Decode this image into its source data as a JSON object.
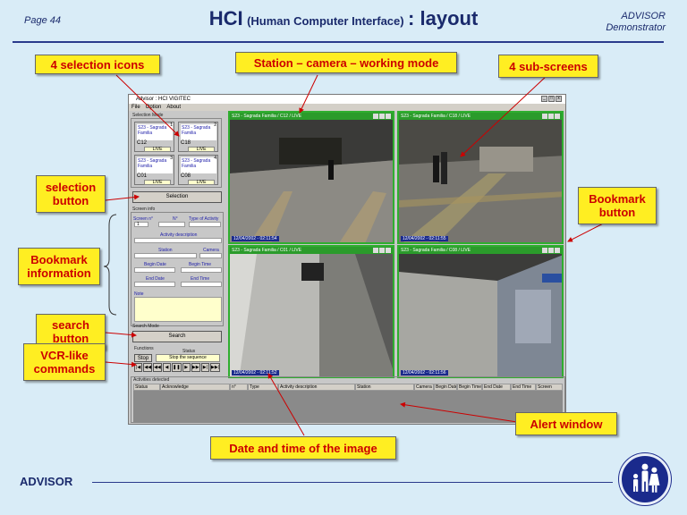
{
  "header": {
    "page": "Page 44",
    "title_main": "HCI",
    "title_paren": "(Human Computer Interface)",
    "title_tail": ": layout",
    "brand_line1": "ADVISOR",
    "brand_line2": "Demonstrator"
  },
  "footer": {
    "label": "ADVISOR"
  },
  "callouts": {
    "selection_icons": "4 selection icons",
    "station_camera": "Station – camera – working mode",
    "sub_screens": "4 sub-screens",
    "selection_button_1": "selection",
    "selection_button_2": "button",
    "bookmark_button_1": "Bookmark",
    "bookmark_button_2": "button",
    "bookmark_info_1": "Bookmark",
    "bookmark_info_2": "information",
    "search_button_1": "search",
    "search_button_2": "button",
    "vcr_1": "VCR-like",
    "vcr_2": "commands",
    "alert_window": "Alert window",
    "date_time": "Date and time of the image"
  },
  "app": {
    "title": "Advisor : HCI VIGITEC",
    "menu": [
      "File",
      "Option",
      "About"
    ],
    "selection_mode": "Selection Mode",
    "selection_label": "Selection",
    "icons": [
      {
        "line1": "S23 - Sagrada",
        "line2": "Familia",
        "cam": "C12",
        "live": "LIVE",
        "num": "1"
      },
      {
        "line1": "S23 - Sagrada",
        "line2": "Familia",
        "cam": "C18",
        "live": "LIVE",
        "num": "2"
      },
      {
        "line1": "S23 - Sagrada",
        "line2": "Familia",
        "cam": "C01",
        "live": "LIVE",
        "num": "3"
      },
      {
        "line1": "S23 - Sagrada",
        "line2": "Familia",
        "cam": "C08",
        "live": "LIVE",
        "num": "4"
      }
    ],
    "screen_info": {
      "group": "Screen info",
      "screen_no": "Screen n°",
      "screen_val": "1",
      "no": "N°",
      "type": "Type of Activity",
      "activity": "Activity description",
      "station": "Station",
      "camera": "Camera",
      "begin_date": "Begin Date",
      "begin_time": "Begin Time",
      "end_date": "End Date",
      "end_time": "End Time",
      "note": "Note"
    },
    "search": {
      "group": "Search Mode",
      "button": "Search",
      "functions": "Functions",
      "status_label": "Status",
      "stop": "Stop",
      "status_value": "Stop the sequence",
      "vcr": [
        "|◀",
        "◀◀",
        "◀◀",
        "◀",
        "❚❚",
        "▶",
        "▶▶",
        "▶|",
        "▶▶|"
      ]
    },
    "subs": [
      {
        "bar": "S23 - Sagrada Familia / C12 / LIVE",
        "ts": "12/04/2002 - 02:11:54"
      },
      {
        "bar": "S23 - Sagrada Familia / C18 / LIVE",
        "ts": "12/04/2002 - 02:11:55"
      },
      {
        "bar": "S23 - Sagrada Familia / C01 / LIVE",
        "ts": "12/04/2002 - 02:11:52"
      },
      {
        "bar": "S23 - Sagrada Familia / C08 / LIVE",
        "ts": "12/04/2002 - 02:11:56"
      }
    ],
    "alerts": {
      "group": "Activities detected",
      "columns": [
        "Status",
        "Acknowledge",
        "n°",
        "Type",
        "Activity description",
        "Station",
        "Camera",
        "Begin Date",
        "Begin Time",
        "End Date",
        "End Time",
        "Screen"
      ]
    }
  },
  "colors": {
    "callout_bg": "#ffee22",
    "callout_text": "#cc0000",
    "title": "#1a2a6c",
    "live_frame": "#2fae2f"
  }
}
